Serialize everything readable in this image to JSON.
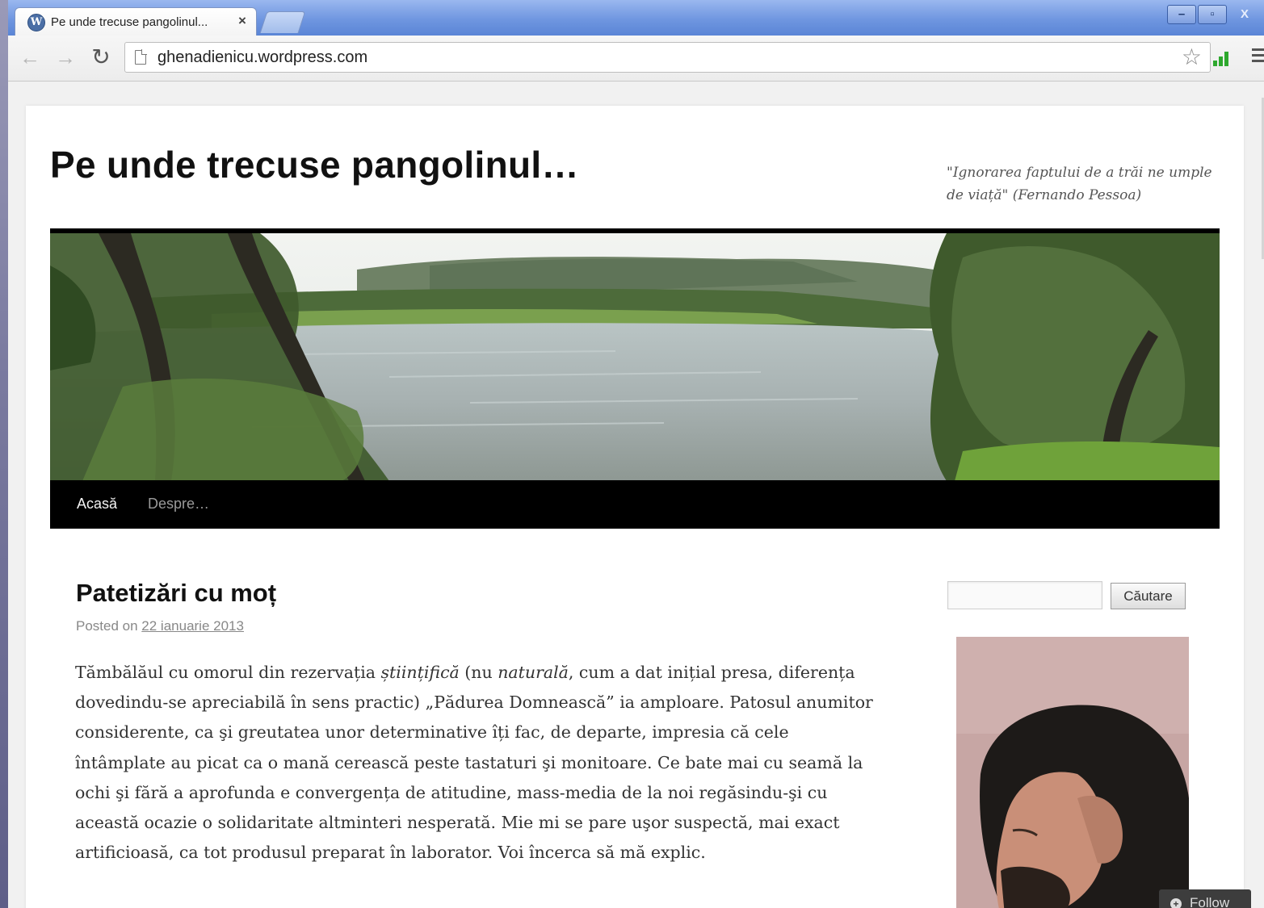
{
  "browser": {
    "tab_title": "Pe unde trecuse pangolinul...",
    "tab_close": "×",
    "tab_icon_letter": "W",
    "url": "ghenadienicu.wordpress.com",
    "window_buttons": {
      "minimize": "–",
      "restore": "▫",
      "close": "X"
    },
    "icons": {
      "back": "back-arrow-icon",
      "forward": "forward-arrow-icon",
      "reload": "reload-icon",
      "page": "page-icon",
      "bookmark": "star-icon",
      "extension": "signal-bars-icon",
      "menu": "hamburger-menu-icon"
    }
  },
  "site": {
    "title": "Pe unde trecuse pangolinul…",
    "description": "\"Ignorarea faptului de a trăi ne umple de viață\" (Fernando Pessoa)"
  },
  "nav": {
    "items": [
      {
        "label": "Acasă"
      },
      {
        "label": "Despre…"
      }
    ]
  },
  "post": {
    "title": "Patetizări cu moț",
    "meta_prefix": "Posted on",
    "date": "22 ianuarie 2013",
    "body": {
      "p1_a": "Tămbălăul cu omorul din rezervația ",
      "p1_em1": "științifică",
      "p1_b": " (nu ",
      "p1_em2": "naturală",
      "p1_c": ", cum a dat inițial presa, diferența dovedindu-se apreciabilă în sens practic) „Pădurea Domnească” ia amploare. Patosul anumitor considerente, ca şi greutatea unor determinative îți fac, de departe, impresia că cele întâmplate au picat ca o mană cerească peste tastaturi şi monitoare. Ce bate mai cu seamă la ochi şi fără a aprofunda e convergența de atitudine, mass-media de la noi regăsindu-şi cu această ocazie o solidaritate altminteri nesperată. Mie mi se pare uşor suspectă, mai exact artificioasă, ca tot produsul preparat în laborator. Voi încerca să mă explic."
    }
  },
  "sidebar": {
    "search_placeholder": "",
    "search_button": "Căutare"
  },
  "follow": {
    "label": "Follow",
    "icon": "+"
  }
}
